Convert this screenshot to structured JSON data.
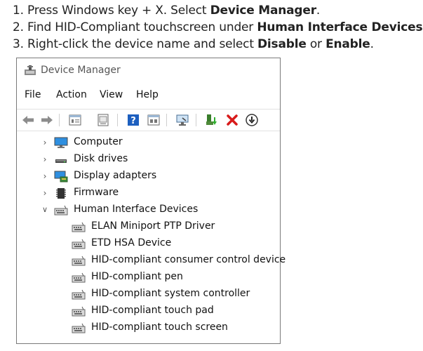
{
  "instructions": [
    {
      "num": "1.",
      "pre": "Press Windows key + X. Select ",
      "bold": "Device Manager",
      "post": "."
    },
    {
      "num": "2.",
      "pre": "Find HID-Compliant touchscreen under ",
      "bold": "Human Interface Devices",
      "post": "."
    },
    {
      "num": "3.",
      "pre": "Right-click the device name and select ",
      "bold": "Disable",
      "mid": " or ",
      "bold2": "Enable",
      "post": "."
    }
  ],
  "window": {
    "title": "Device Manager",
    "menu": [
      "File",
      "Action",
      "View",
      "Help"
    ],
    "toolbar_icons": [
      "back-arrow-icon",
      "forward-arrow-icon",
      "properties-icon",
      "show-hidden-icon",
      "help-icon",
      "details-icon",
      "scan-hardware-icon",
      "update-driver-icon",
      "uninstall-x-icon",
      "disable-device-icon"
    ]
  },
  "tree": {
    "categories": [
      {
        "label": "Computer",
        "icon": "monitor-icon",
        "expanded": false
      },
      {
        "label": "Disk drives",
        "icon": "disk-drive-icon",
        "expanded": false
      },
      {
        "label": "Display adapters",
        "icon": "display-adapter-icon",
        "expanded": false
      },
      {
        "label": "Firmware",
        "icon": "firmware-icon",
        "expanded": false
      },
      {
        "label": "Human Interface Devices",
        "icon": "hid-icon",
        "expanded": true
      }
    ],
    "hid_children": [
      "ELAN Miniport PTP Driver",
      "ETD HSA Device",
      "HID-compliant consumer control device",
      "HID-compliant pen",
      "HID-compliant system controller",
      "HID-compliant touch pad",
      "HID-compliant touch screen"
    ]
  }
}
